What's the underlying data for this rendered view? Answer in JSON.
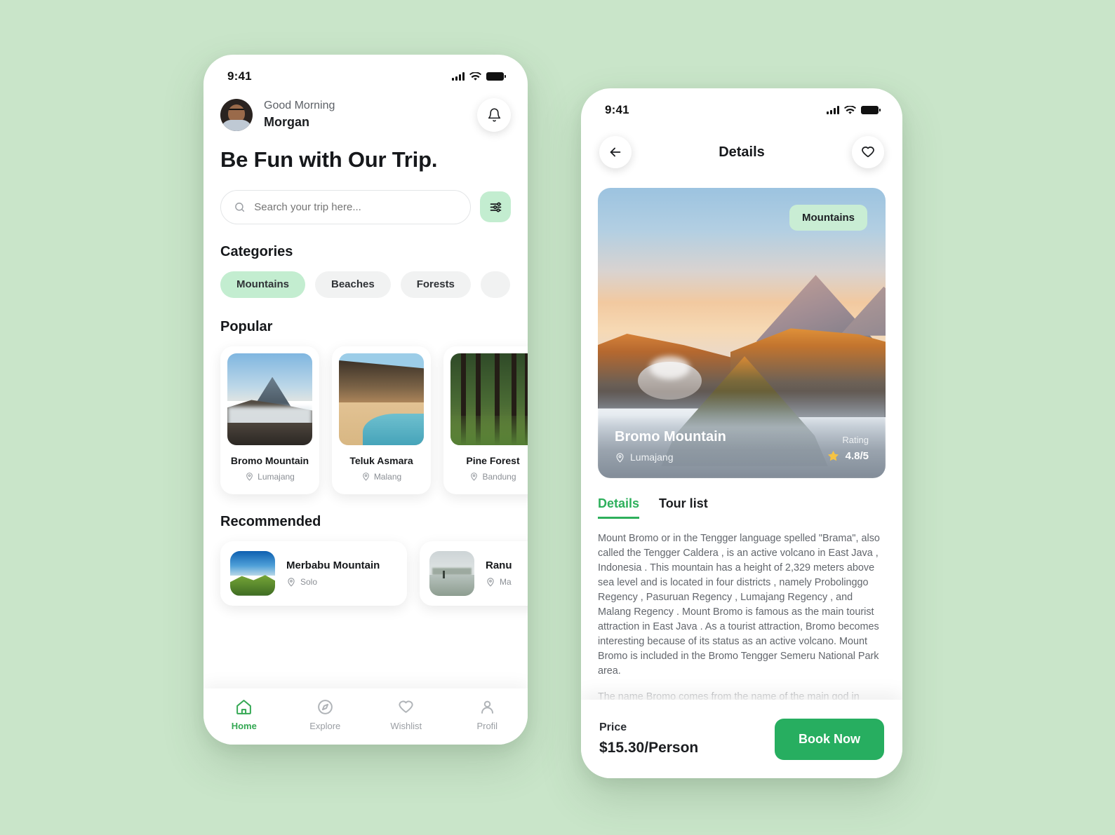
{
  "theme": {
    "page_background": "#c9e5c9",
    "accent_green": "#27ae60",
    "mint": "#c3edd0",
    "tab_active": "#2eb05c",
    "star": "#f6c343"
  },
  "home": {
    "status_bar": {
      "time": "9:41"
    },
    "header": {
      "greeting": "Good Morning",
      "user_name": "Morgan",
      "notification_icon": "bell-icon"
    },
    "hero_title": "Be Fun with Our Trip.",
    "search": {
      "placeholder": "Search your trip here...",
      "value": "",
      "icon": "search-icon",
      "filter_icon": "sliders-icon"
    },
    "categories": {
      "title": "Categories",
      "items": [
        {
          "label": "Mountains",
          "active": true
        },
        {
          "label": "Beaches",
          "active": false
        },
        {
          "label": "Forests",
          "active": false
        },
        {
          "label": "",
          "active": false
        }
      ]
    },
    "popular": {
      "title": "Popular",
      "items": [
        {
          "name": "Bromo Mountain",
          "location": "Lumajang"
        },
        {
          "name": "Teluk Asmara",
          "location": "Malang"
        },
        {
          "name": "Pine Forest",
          "location": "Bandung"
        }
      ]
    },
    "recommended": {
      "title": "Recommended",
      "items": [
        {
          "name": "Merbabu Mountain",
          "location": "Solo"
        },
        {
          "name": "Ranu",
          "location": "Ma"
        }
      ]
    },
    "tabbar": [
      {
        "label": "Home",
        "icon": "home-icon",
        "active": true
      },
      {
        "label": "Explore",
        "icon": "compass-icon",
        "active": false
      },
      {
        "label": "Wishlist",
        "icon": "heart-icon",
        "active": false
      },
      {
        "label": "Profil",
        "icon": "user-icon",
        "active": false
      }
    ]
  },
  "details": {
    "status_bar": {
      "time": "9:41"
    },
    "header": {
      "back_icon": "arrow-left-icon",
      "title": "Details",
      "favorite_icon": "heart-icon"
    },
    "hero": {
      "badge": "Mountains",
      "name": "Bromo Mountain",
      "location": "Lumajang",
      "rating_label": "Rating",
      "rating_value": "4.8/5",
      "star_icon": "star-icon"
    },
    "tabs": [
      {
        "label": "Details",
        "active": true
      },
      {
        "label": "Tour list",
        "active": false
      }
    ],
    "paragraphs": [
      "Mount Bromo or in the Tengger language spelled \"Brama\", also called the Tengger Caldera , is an active volcano in East Java , Indonesia . This mountain has a height of 2,329 meters above sea level and is located in four districts , namely Probolinggo Regency , Pasuruan Regency , Lumajang Regency , and Malang Regency . Mount Bromo is famous as the main tourist attraction in East Java . As a tourist attraction, Bromo becomes interesting because of its status as an active volcano. Mount Bromo is included in the Bromo Tengger Semeru National Park area.",
      "The name Bromo comes from the name of the main god in Hinduism, Brahma. The body shape of Mount Bromo is…"
    ],
    "footer": {
      "price_label": "Price",
      "price_value": "$15.30/Person",
      "book_label": "Book Now"
    }
  }
}
